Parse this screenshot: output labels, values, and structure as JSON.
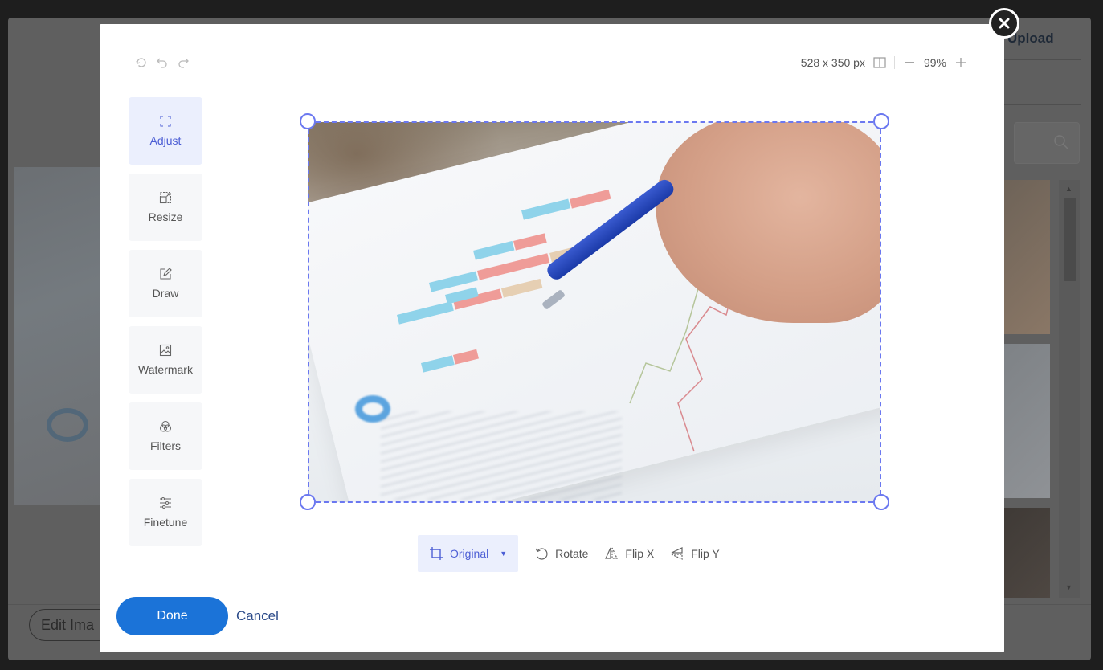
{
  "background": {
    "upload_label": "Upload",
    "edit_button_label": "Edit Ima"
  },
  "editor": {
    "image_size": "528 x 350 px",
    "zoom_level": "99%",
    "tools": [
      {
        "id": "adjust",
        "label": "Adjust",
        "icon": "crop-corners-icon",
        "active": true
      },
      {
        "id": "resize",
        "label": "Resize",
        "icon": "resize-icon",
        "active": false
      },
      {
        "id": "draw",
        "label": "Draw",
        "icon": "pencil-square-icon",
        "active": false
      },
      {
        "id": "watermark",
        "label": "Watermark",
        "icon": "image-icon",
        "active": false
      },
      {
        "id": "filters",
        "label": "Filters",
        "icon": "circles-icon",
        "active": false
      },
      {
        "id": "finetune",
        "label": "Finetune",
        "icon": "sliders-icon",
        "active": false
      }
    ],
    "crop_toolbar": {
      "ratio_label": "Original",
      "rotate_label": "Rotate",
      "flip_x_label": "Flip X",
      "flip_y_label": "Flip Y"
    },
    "done_label": "Done",
    "cancel_label": "Cancel"
  },
  "colors": {
    "accent": "#4d5fd5",
    "primary_button": "#1b73d8",
    "crop_border": "#6b78f0"
  }
}
